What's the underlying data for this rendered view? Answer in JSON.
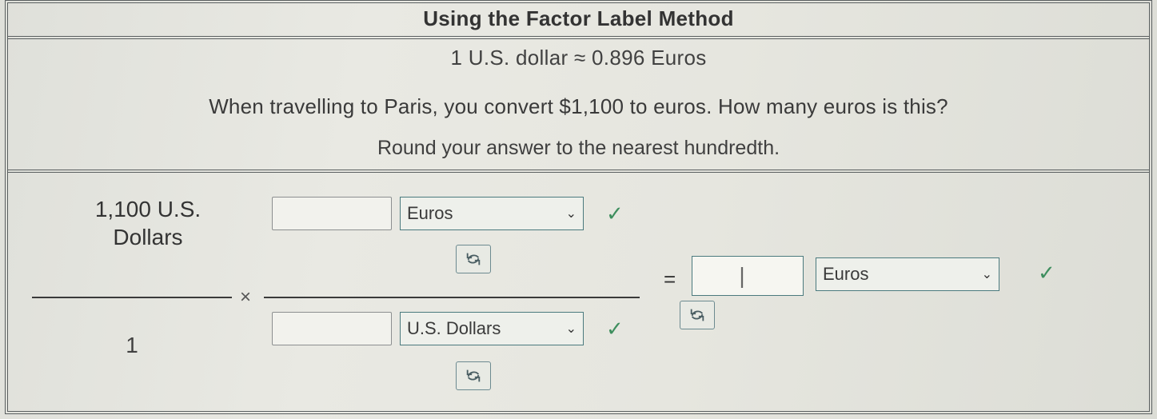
{
  "title": "Using the Factor Label Method",
  "rate_text": "1 U.S. dollar ≈ 0.896 Euros",
  "question": "When travelling to Paris, you convert $1,100 to euros. How many euros is this?",
  "instruction": "Round your answer to the nearest hundredth.",
  "start": {
    "numerator_line1": "1,100 U.S.",
    "numerator_line2": "Dollars",
    "denominator": "1"
  },
  "operator_times": "×",
  "conversion": {
    "num_value": "",
    "num_unit": "Euros",
    "den_value": "",
    "den_unit": "U.S. Dollars"
  },
  "equals": "=",
  "answer": {
    "value": "",
    "unit": "Euros"
  },
  "icons": {
    "check": "✓",
    "chevron": "⌄"
  }
}
